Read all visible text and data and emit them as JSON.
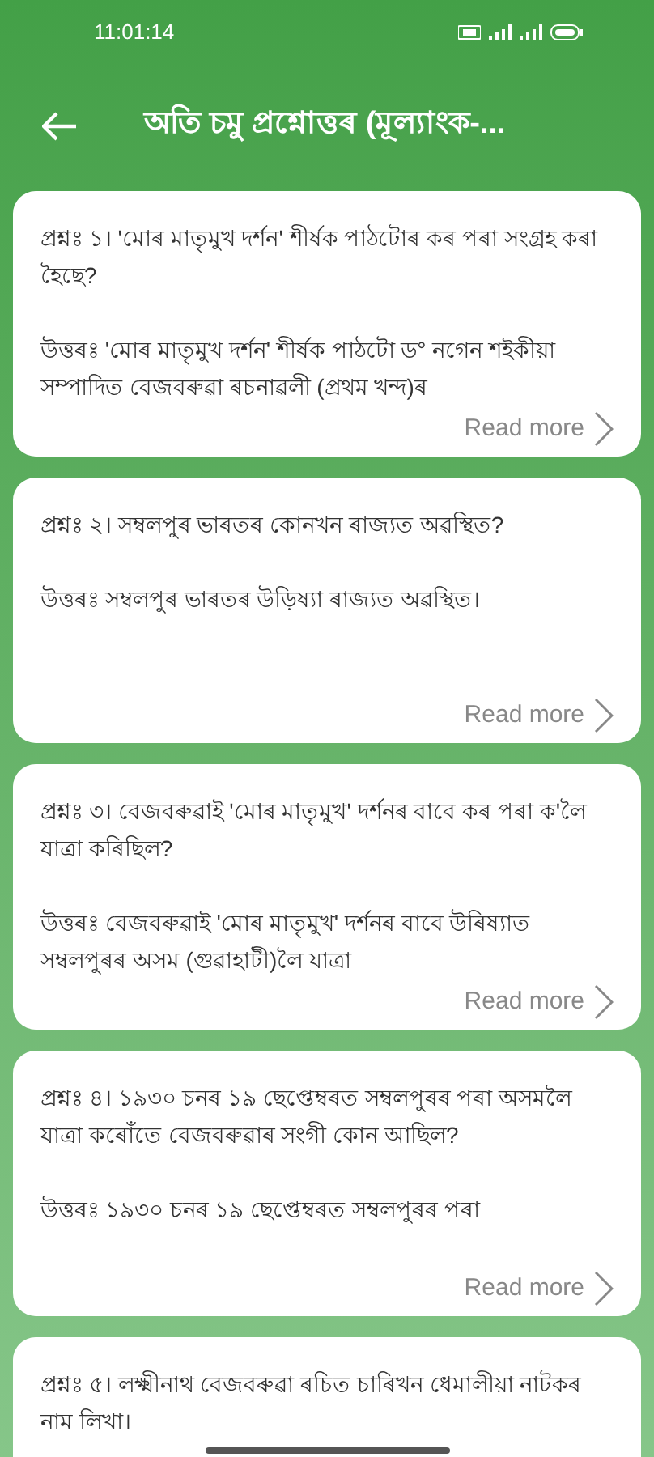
{
  "status_bar": {
    "time": "11:01:14"
  },
  "app_bar": {
    "title": "অতি চমু প্ৰশ্নোত্তৰ (মূল্যাংক-..."
  },
  "cards": [
    {
      "question": "প্ৰশ্নঃ ১। 'মোৰ মাতৃমুখ দৰ্শন' শীৰ্ষক পাঠটোৰ কৰ পৰা সংগ্ৰহ কৰা হৈছে?",
      "answer": "উত্তৰঃ 'মোৰ মাতৃমুখ দৰ্শন' শীৰ্ষক পাঠটো ড° নগেন শইকীয়া সম্পাদিত বেজবৰুৱা ৰচনাৱলী (প্ৰথম খন্দ)ৰ",
      "link": "Read more"
    },
    {
      "question": "প্ৰশ্নঃ ২। সম্বলপুৰ ভাৰতৰ কোনখন ৰাজ্যত অৱস্থিত?",
      "answer": "উত্তৰঃ সম্বলপুৰ ভাৰতৰ উড়িষ্যা ৰাজ্যত অৱস্থিত।",
      "link": "Read more"
    },
    {
      "question": "প্ৰশ্নঃ ৩। বেজবৰুৱাই 'মোৰ মাতৃমুখ' দৰ্শনৰ বাবে কৰ পৰা ক'লৈ যাত্ৰা কৰিছিল?",
      "answer": "উত্তৰঃ বেজবৰুৱাই 'মোৰ মাতৃমুখ' দৰ্শনৰ বাবে উৰিষ্যাত সম্বলপুৰৰ অসম (গুৱাহাটী)লৈ যাত্ৰা",
      "link": "Read more"
    },
    {
      "question": "প্ৰশ্নঃ ৪। ১৯৩০ চনৰ ১৯ ছেপ্তেম্বৰত সম্বলপুৰৰ পৰা অসমলৈ যাত্ৰা কৰোঁতে বেজবৰুৱাৰ সংগী কোন আছিল?",
      "answer": "উত্তৰঃ ১৯৩০ চনৰ ১৯ ছেপ্তেম্বৰত সম্বলপুৰৰ পৰা",
      "link": "Read more"
    },
    {
      "question": "প্ৰশ্নঃ ৫। লক্ষ্মীনাথ বেজবৰুৱা ৰচিত চাৰিখন ধেমালীয়া নাটকৰ নাম লিখা।"
    }
  ]
}
